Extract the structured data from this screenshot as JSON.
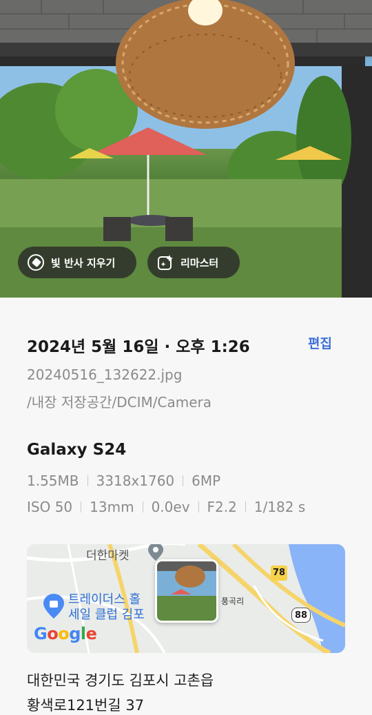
{
  "photo_actions": {
    "erase_reflection": "빛 반사 지우기",
    "remaster": "리마스터"
  },
  "details": {
    "datetime": "2024년 5월 16일 · 오후 1:26",
    "edit_label": "편집",
    "filename": "20240516_132622.jpg",
    "path": "/내장 저장공간/DCIM/Camera"
  },
  "device": {
    "model": "Galaxy S24",
    "size": "1.55MB",
    "resolution": "3318x1760",
    "megapixels": "6MP",
    "iso": "ISO 50",
    "focal": "13mm",
    "ev": "0.0ev",
    "aperture": "F2.2",
    "shutter": "1/182 s"
  },
  "map": {
    "place1": "더한마켓",
    "place2_line1": "트레이더스 홀",
    "place2_line2": "세일 클럽 김포",
    "village": "풍곡리",
    "route_78": "78",
    "route_88": "88",
    "brand": "Google",
    "colors": {
      "blue": "#4285f4",
      "red": "#ea4335",
      "yellow": "#fbbc05",
      "green": "#34a853"
    }
  },
  "address": {
    "line1": "대한민국 경기도 김포시 고촌읍",
    "line2": "황색로121번길 37"
  }
}
